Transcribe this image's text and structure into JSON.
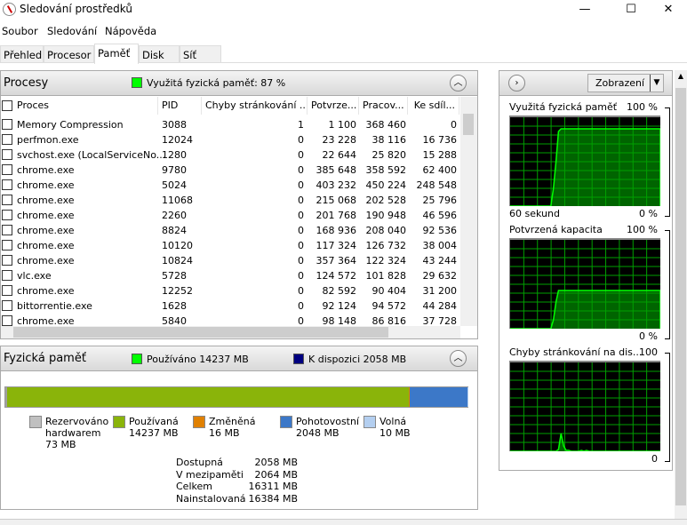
{
  "window": {
    "title": "Sledování prostředků",
    "minimize": "—",
    "maximize": "☐",
    "close": "✕"
  },
  "menu": [
    "Soubor",
    "Sledování",
    "Nápověda"
  ],
  "tabs": [
    {
      "label": "Přehled"
    },
    {
      "label": "Procesor"
    },
    {
      "label": "Paměť",
      "active": true
    },
    {
      "label": "Disk"
    },
    {
      "label": "Síť"
    }
  ],
  "processes": {
    "title": "Procesy",
    "indicator": {
      "label": "Využitá fyzická paměť: 87 %",
      "color": "#00ff00"
    },
    "columns": [
      "Proces",
      "PID",
      "Chyby stránkování ...",
      "Potvrze...",
      "Pracov...",
      "Ke sdíl..."
    ],
    "rows": [
      [
        "Memory Compression",
        "3088",
        "1",
        "1 100",
        "368 460",
        "0"
      ],
      [
        "perfmon.exe",
        "12024",
        "0",
        "23 228",
        "38 116",
        "16 736"
      ],
      [
        "svchost.exe (LocalServiceNo...",
        "1280",
        "0",
        "22 644",
        "25 820",
        "15 288"
      ],
      [
        "chrome.exe",
        "9780",
        "0",
        "385 648",
        "358 592",
        "62 400"
      ],
      [
        "chrome.exe",
        "5024",
        "0",
        "403 232",
        "450 224",
        "248 548"
      ],
      [
        "chrome.exe",
        "11068",
        "0",
        "215 068",
        "202 528",
        "25 796"
      ],
      [
        "chrome.exe",
        "2260",
        "0",
        "201 768",
        "190 948",
        "46 596"
      ],
      [
        "chrome.exe",
        "8824",
        "0",
        "168 936",
        "208 040",
        "92 536"
      ],
      [
        "chrome.exe",
        "10120",
        "0",
        "117 324",
        "126 732",
        "38 004"
      ],
      [
        "chrome.exe",
        "10824",
        "0",
        "357 364",
        "122 324",
        "43 244"
      ],
      [
        "vlc.exe",
        "5728",
        "0",
        "124 572",
        "101 828",
        "29 632"
      ],
      [
        "chrome.exe",
        "12252",
        "0",
        "82 592",
        "90 404",
        "31 200"
      ],
      [
        "bittorrentie.exe",
        "1628",
        "0",
        "92 124",
        "94 572",
        "44 284"
      ],
      [
        "chrome.exe",
        "5840",
        "0",
        "98 148",
        "86 816",
        "37 728"
      ]
    ]
  },
  "physical": {
    "title": "Fyzická paměť",
    "used_label": "Používáno 14237 MB",
    "used_color": "#00ff00",
    "available_label": "K dispozici 2058 MB",
    "available_color": "#000080",
    "bar": [
      {
        "mb": 73,
        "color": "#a0a0a0"
      },
      {
        "mb": 14237,
        "color": "#8ab40a"
      },
      {
        "mb": 16,
        "color": "#e08000"
      },
      {
        "mb": 2048,
        "color": "#3c78c8"
      },
      {
        "mb": 10,
        "color": "#b4cff0"
      }
    ],
    "legend": [
      {
        "label": "Rezervováno\nhardwarem\n73 MB",
        "color": "#c0c0c0"
      },
      {
        "label": "Používaná\n14237 MB",
        "color": "#8ab40a"
      },
      {
        "label": "Změněná\n16 MB",
        "color": "#e08000"
      },
      {
        "label": "Pohotovostní\n2048 MB",
        "color": "#3c78c8"
      },
      {
        "label": "Volná\n10 MB",
        "color": "#b4cff0"
      }
    ],
    "stats": [
      [
        "Dostupná",
        "2058 MB"
      ],
      [
        "V mezipaměti",
        "2064 MB"
      ],
      [
        "Celkem",
        "16311 MB"
      ],
      [
        "Nainstalovaná",
        "16384 MB"
      ]
    ]
  },
  "right": {
    "view_button": "Zobrazení",
    "graphs": [
      {
        "title": "Využitá fyzická paměť",
        "max": "100 %",
        "min": "0 %",
        "time": "60 sekund",
        "values": [
          0,
          0,
          0,
          0,
          0,
          0,
          0,
          0,
          0,
          0,
          0,
          0,
          0,
          0,
          0,
          0,
          0,
          20,
          50,
          84,
          87,
          87,
          87,
          87,
          87,
          87,
          87,
          87,
          87,
          87,
          87,
          87,
          87,
          87,
          87,
          87,
          87,
          87,
          87,
          87,
          87,
          87,
          87,
          87,
          87,
          87,
          87,
          87,
          87,
          87,
          87,
          87,
          87,
          87,
          87,
          87,
          87,
          87,
          87,
          87
        ]
      },
      {
        "title": "Potvrzená kapacita",
        "max": "100 %",
        "min": "0 %",
        "values": [
          0,
          0,
          0,
          0,
          0,
          0,
          0,
          0,
          0,
          0,
          0,
          0,
          0,
          0,
          0,
          0,
          0,
          10,
          30,
          43,
          43,
          43,
          43,
          43,
          43,
          43,
          43,
          43,
          43,
          43,
          43,
          43,
          43,
          43,
          43,
          43,
          43,
          43,
          43,
          43,
          43,
          43,
          43,
          43,
          43,
          43,
          43,
          43,
          43,
          43,
          43,
          43,
          43,
          43,
          43,
          43,
          43,
          43,
          43,
          43
        ]
      },
      {
        "title": "Chyby stránkování na dis...",
        "max": "100",
        "min": "0",
        "values": [
          0,
          0,
          0,
          0,
          0,
          0,
          0,
          0,
          0,
          0,
          0,
          0,
          0,
          0,
          0,
          0,
          0,
          0,
          0,
          2,
          20,
          6,
          1,
          1,
          0,
          0,
          0,
          0,
          1,
          0,
          1,
          0,
          0,
          0,
          0,
          0,
          0,
          0,
          0,
          0,
          0,
          0,
          0,
          0,
          0,
          0,
          0,
          0,
          0,
          0,
          0,
          0,
          0,
          0,
          0,
          0,
          0,
          0,
          0,
          0
        ]
      }
    ]
  }
}
